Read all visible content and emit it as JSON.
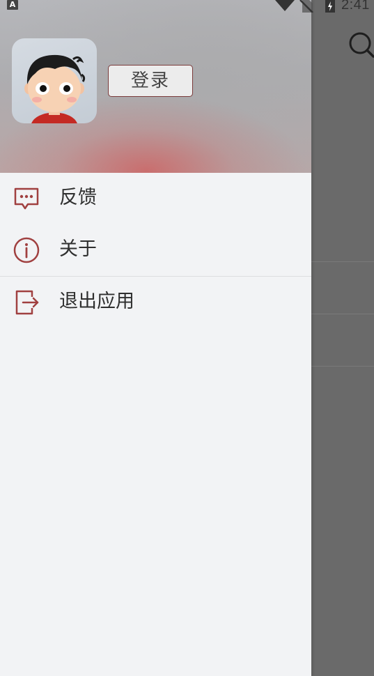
{
  "status_bar": {
    "left_icon_letter": "A",
    "time": "2:41",
    "icons": [
      "wifi-icon",
      "no-sim-icon",
      "battery-charging-icon"
    ]
  },
  "drawer": {
    "login_label": "登录",
    "menu": [
      {
        "label": "反馈",
        "icon": "feedback-icon"
      },
      {
        "label": "关于",
        "icon": "info-icon"
      },
      {
        "label": "退出应用",
        "icon": "exit-icon"
      }
    ]
  },
  "background": {
    "icons": [
      "search-icon"
    ]
  },
  "colors": {
    "accent": "#a04040",
    "drawer_bg": "#f2f3f5",
    "scrim": "#6a6a6a"
  }
}
